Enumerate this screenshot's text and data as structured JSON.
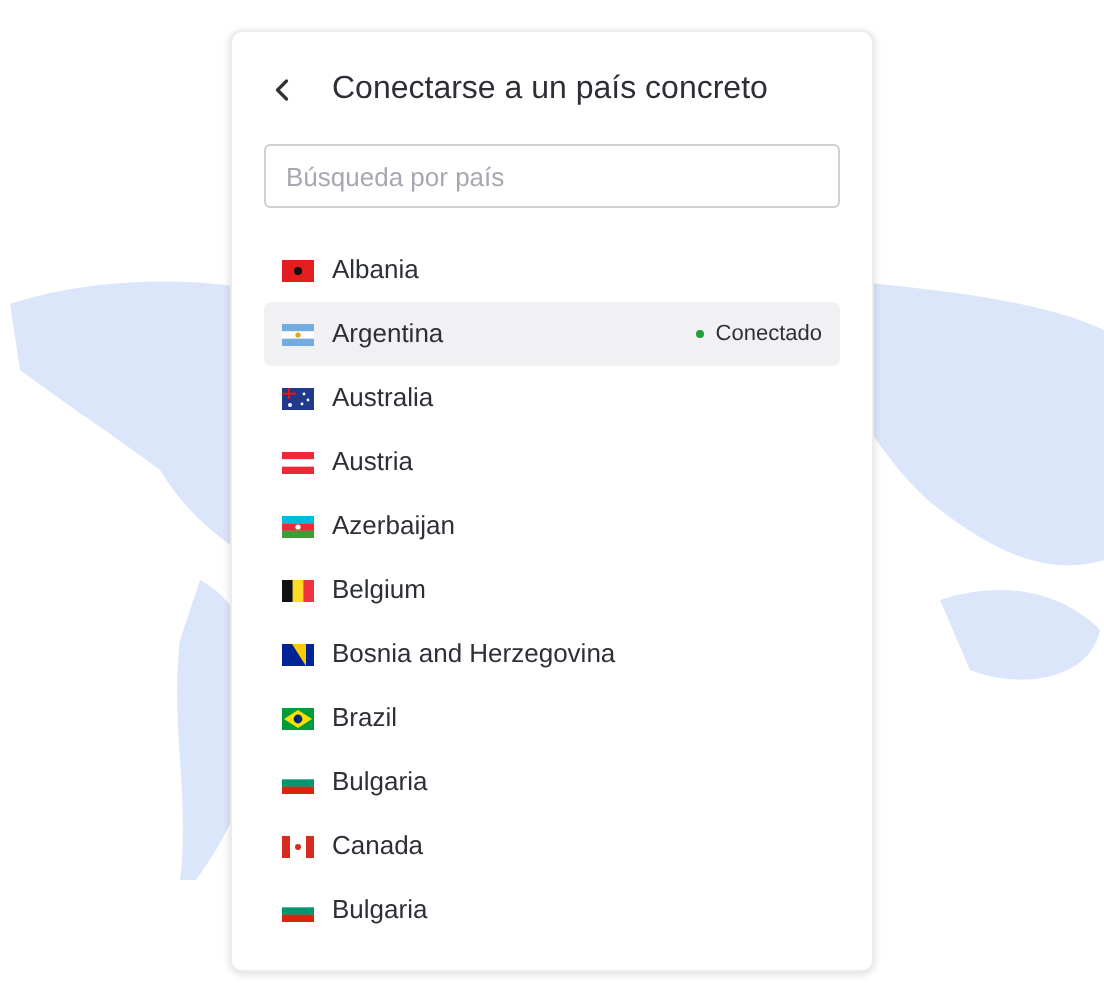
{
  "header": {
    "title": "Conectarse a un país concreto"
  },
  "search": {
    "placeholder": "Búsqueda por país"
  },
  "countries": [
    {
      "name": "Albania",
      "kind": "al",
      "selected": false
    },
    {
      "name": "Argentina",
      "kind": "ar",
      "selected": true,
      "status": "Conectado"
    },
    {
      "name": "Australia",
      "kind": "au",
      "selected": false
    },
    {
      "name": "Austria",
      "kind": "at",
      "selected": false
    },
    {
      "name": "Azerbaijan",
      "kind": "az",
      "selected": false
    },
    {
      "name": "Belgium",
      "kind": "be",
      "selected": false
    },
    {
      "name": "Bosnia and Herzegovina",
      "kind": "ba",
      "selected": false
    },
    {
      "name": "Brazil",
      "kind": "br",
      "selected": false
    },
    {
      "name": "Bulgaria",
      "kind": "bg",
      "selected": false
    },
    {
      "name": "Canada",
      "kind": "ca",
      "selected": false
    },
    {
      "name": "Bulgaria",
      "kind": "bg",
      "selected": false
    }
  ]
}
